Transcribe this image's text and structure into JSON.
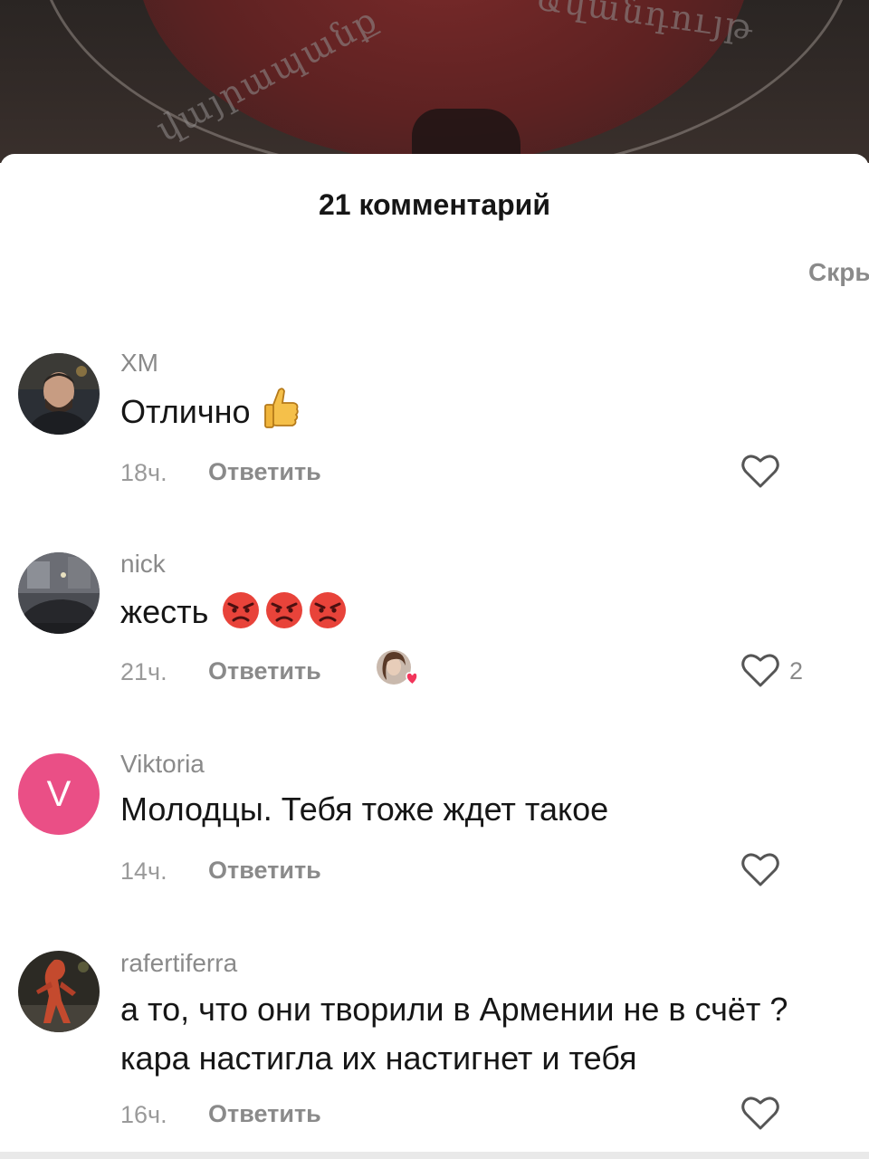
{
  "header": {
    "title": "21 комментарий",
    "hide_label": "Скры"
  },
  "background_text": [
    "վայրապանք",
    "Ավանդույթ",
    "Լ",
    "ը"
  ],
  "comments": [
    {
      "username": "XM",
      "text": "Отлично",
      "emoji": "thumbs-up",
      "time": "18ч.",
      "reply": "Ответить",
      "likes": ""
    },
    {
      "username": "nick",
      "text": "жесть",
      "emoji": "angry-face x3",
      "time": "21ч.",
      "reply": "Ответить",
      "likes": "2",
      "creator_liked": true
    },
    {
      "username": "Viktoria",
      "avatar_letter": "V",
      "text": "Молодцы. Тебя тоже ждет такое",
      "time": "14ч.",
      "reply": "Ответить",
      "likes": ""
    },
    {
      "username": "rafertiferra",
      "text": "а то, что они творили в Армении не в счёт ? кара настигла их настигнет и тебя",
      "time": "16ч.",
      "reply": "Ответить",
      "likes": ""
    }
  ],
  "colors": {
    "username": "#8a8a8a",
    "text": "#161616",
    "avatar_v": "#ea4f86",
    "heart_outline": "#555555"
  }
}
